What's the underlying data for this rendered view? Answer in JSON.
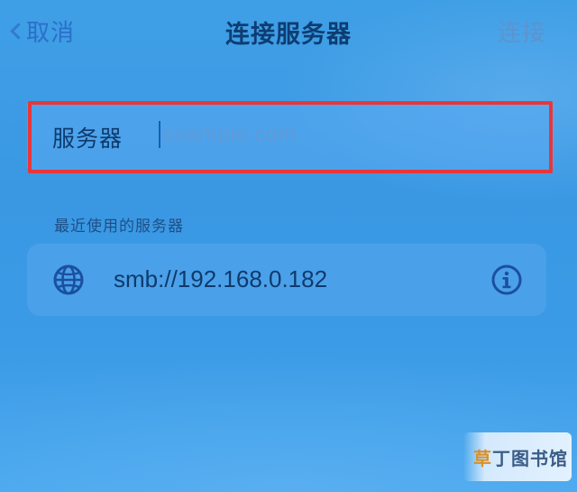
{
  "navbar": {
    "cancel_label": "取消",
    "title": "连接服务器",
    "connect_label": "连接"
  },
  "server_field": {
    "label": "服务器",
    "placeholder": "example.com",
    "value": ""
  },
  "recent": {
    "header": "最近使用的服务器",
    "items": [
      {
        "address": "smb://192.168.0.182",
        "icon": "globe-icon",
        "action_icon": "info-icon"
      }
    ]
  },
  "watermark": {
    "brand_prefix": "草",
    "brand_rest": "丁图书馆"
  },
  "colors": {
    "background": "#3b9be6",
    "accent": "#2b6fc8",
    "highlight_border": "#e8363b",
    "text_dark": "#0f3a6c"
  }
}
